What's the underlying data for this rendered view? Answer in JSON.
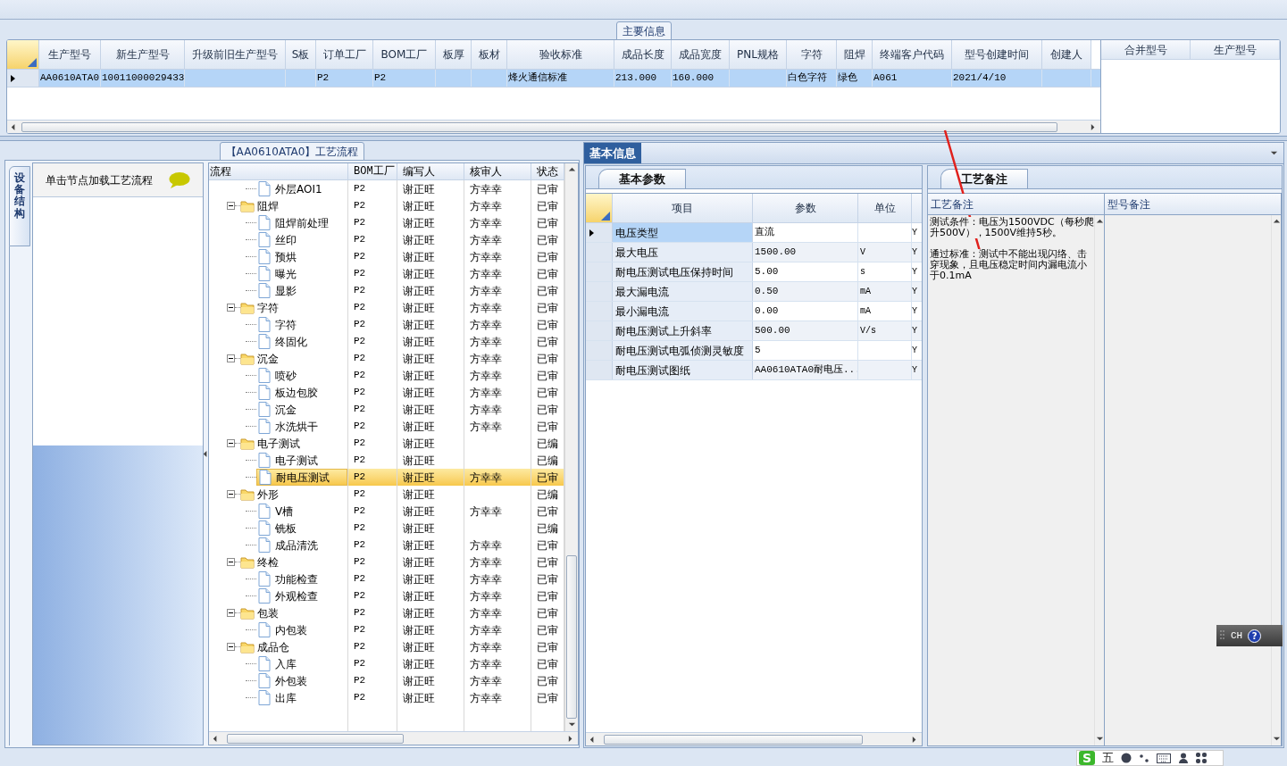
{
  "main_info": {
    "tab": "主要信息",
    "columns": [
      "生产型号",
      "新生产型号",
      "升级前旧生产型号",
      "S板",
      "订单工厂",
      "BOM工厂",
      "板厚",
      "板材",
      "验收标准",
      "成品长度",
      "成品宽度",
      "PNL规格",
      "字符",
      "阻焊",
      "终端客户代码",
      "型号创建时间",
      "创建人"
    ],
    "rows": [
      {
        "selected": true,
        "cells": [
          "AA0610ATA0",
          "10011000029433",
          null,
          null,
          "P2",
          "P2",
          null,
          null,
          "烽火通信标准",
          "213.000",
          "160.000",
          null,
          "白色字符",
          "绿色",
          "A061",
          "2021/4/10",
          null
        ]
      }
    ],
    "side_grid": {
      "columns": [
        "合并型号",
        "生产型号"
      ]
    }
  },
  "process_panel": {
    "tab": "【AA0610ATA0】工艺流程",
    "side_tab": "设备结构",
    "hint": "单击节点加载工艺流程",
    "tree": {
      "columns": [
        "流程",
        "BOM工厂",
        "编写人",
        "核审人",
        "状态"
      ],
      "nodes": [
        {
          "kind": "file",
          "label": "外层AOI1",
          "bom": "P2",
          "author": "谢正旺",
          "reviewer": "方幸幸",
          "status": "已审",
          "selected": false
        },
        {
          "kind": "folder",
          "label": "阻焊",
          "bom": "P2",
          "author": "谢正旺",
          "reviewer": "方幸幸",
          "status": "已审",
          "selected": false,
          "expanded": true,
          "children": [
            {
              "kind": "file",
              "label": "阻焊前处理",
              "bom": "P2",
              "author": "谢正旺",
              "reviewer": "方幸幸",
              "status": "已审",
              "selected": false
            },
            {
              "kind": "file",
              "label": "丝印",
              "bom": "P2",
              "author": "谢正旺",
              "reviewer": "方幸幸",
              "status": "已审",
              "selected": false
            },
            {
              "kind": "file",
              "label": "预烘",
              "bom": "P2",
              "author": "谢正旺",
              "reviewer": "方幸幸",
              "status": "已审",
              "selected": false
            },
            {
              "kind": "file",
              "label": "曝光",
              "bom": "P2",
              "author": "谢正旺",
              "reviewer": "方幸幸",
              "status": "已审",
              "selected": false
            },
            {
              "kind": "file",
              "label": "显影",
              "bom": "P2",
              "author": "谢正旺",
              "reviewer": "方幸幸",
              "status": "已审",
              "selected": false
            }
          ]
        },
        {
          "kind": "folder",
          "label": "字符",
          "bom": "P2",
          "author": "谢正旺",
          "reviewer": "方幸幸",
          "status": "已审",
          "selected": false,
          "expanded": true,
          "children": [
            {
              "kind": "file",
              "label": "字符",
              "bom": "P2",
              "author": "谢正旺",
              "reviewer": "方幸幸",
              "status": "已审",
              "selected": false
            },
            {
              "kind": "file",
              "label": "终固化",
              "bom": "P2",
              "author": "谢正旺",
              "reviewer": "方幸幸",
              "status": "已审",
              "selected": false
            }
          ]
        },
        {
          "kind": "folder",
          "label": "沉金",
          "bom": "P2",
          "author": "谢正旺",
          "reviewer": "方幸幸",
          "status": "已审",
          "selected": false,
          "expanded": true,
          "children": [
            {
              "kind": "file",
              "label": "喷砂",
              "bom": "P2",
              "author": "谢正旺",
              "reviewer": "方幸幸",
              "status": "已审",
              "selected": false
            },
            {
              "kind": "file",
              "label": "板边包胶",
              "bom": "P2",
              "author": "谢正旺",
              "reviewer": "方幸幸",
              "status": "已审",
              "selected": false
            },
            {
              "kind": "file",
              "label": "沉金",
              "bom": "P2",
              "author": "谢正旺",
              "reviewer": "方幸幸",
              "status": "已审",
              "selected": false
            },
            {
              "kind": "file",
              "label": "水洗烘干",
              "bom": "P2",
              "author": "谢正旺",
              "reviewer": "方幸幸",
              "status": "已审",
              "selected": false
            }
          ]
        },
        {
          "kind": "folder",
          "label": "电子测试",
          "bom": "P2",
          "author": "谢正旺",
          "status": "已编",
          "selected": false,
          "expanded": true,
          "children": [
            {
              "kind": "file",
              "label": "电子测试",
              "bom": "P2",
              "author": "谢正旺",
              "status": "已编",
              "selected": false
            },
            {
              "kind": "file",
              "label": "耐电压测试",
              "bom": "P2",
              "author": "谢正旺",
              "reviewer": "方幸幸",
              "status": "已审",
              "selected": true
            }
          ]
        },
        {
          "kind": "folder",
          "label": "外形",
          "bom": "P2",
          "author": "谢正旺",
          "status": "已编",
          "selected": false,
          "expanded": true,
          "children": [
            {
              "kind": "file",
              "label": "V槽",
              "bom": "P2",
              "author": "谢正旺",
              "reviewer": "方幸幸",
              "status": "已审",
              "selected": false
            },
            {
              "kind": "file",
              "label": "铣板",
              "bom": "P2",
              "author": "谢正旺",
              "status": "已编",
              "selected": false
            },
            {
              "kind": "file",
              "label": "成品清洗",
              "bom": "P2",
              "author": "谢正旺",
              "reviewer": "方幸幸",
              "status": "已审",
              "selected": false
            }
          ]
        },
        {
          "kind": "folder",
          "label": "终检",
          "bom": "P2",
          "author": "谢正旺",
          "reviewer": "方幸幸",
          "status": "已审",
          "selected": false,
          "expanded": true,
          "children": [
            {
              "kind": "file",
              "label": "功能检查",
              "bom": "P2",
              "author": "谢正旺",
              "reviewer": "方幸幸",
              "status": "已审",
              "selected": false
            },
            {
              "kind": "file",
              "label": "外观检查",
              "bom": "P2",
              "author": "谢正旺",
              "reviewer": "方幸幸",
              "status": "已审",
              "selected": false
            }
          ]
        },
        {
          "kind": "folder",
          "label": "包装",
          "bom": "P2",
          "author": "谢正旺",
          "reviewer": "方幸幸",
          "status": "已审",
          "selected": false,
          "expanded": true,
          "children": [
            {
              "kind": "file",
              "label": "内包装",
              "bom": "P2",
              "author": "谢正旺",
              "reviewer": "方幸幸",
              "status": "已审",
              "selected": false
            }
          ]
        },
        {
          "kind": "folder",
          "label": "成品仓",
          "bom": "P2",
          "author": "谢正旺",
          "reviewer": "方幸幸",
          "status": "已审",
          "selected": false,
          "expanded": true,
          "children": [
            {
              "kind": "file",
              "label": "入库",
              "bom": "P2",
              "author": "谢正旺",
              "reviewer": "方幸幸",
              "status": "已审",
              "selected": false
            },
            {
              "kind": "file",
              "label": "外包装",
              "bom": "P2",
              "author": "谢正旺",
              "reviewer": "方幸幸",
              "status": "已审",
              "selected": false
            },
            {
              "kind": "file",
              "label": "出库",
              "bom": "P2",
              "author": "谢正旺",
              "reviewer": "方幸幸",
              "status": "已审",
              "selected": false
            }
          ]
        }
      ]
    }
  },
  "detail_panel": {
    "tab": "基本信息",
    "params": {
      "tab": "基本参数",
      "columns": [
        "项目",
        "参数",
        "单位"
      ],
      "rows": [
        {
          "selected": true,
          "item": "电压类型",
          "value": "直流",
          "flag": "Y"
        },
        {
          "selected": false,
          "item": "最大电压",
          "value": "1500.00",
          "unit": "V",
          "flag": "Y"
        },
        {
          "selected": false,
          "item": "耐电压测试电压保持时间",
          "value": "5.00",
          "unit": "s",
          "flag": "Y"
        },
        {
          "selected": false,
          "item": "最大漏电流",
          "value": "0.50",
          "unit": "mA",
          "flag": "Y"
        },
        {
          "selected": false,
          "item": "最小漏电流",
          "value": "0.00",
          "unit": "mA",
          "flag": "Y"
        },
        {
          "selected": false,
          "item": "耐电压测试上升斜率",
          "value": "500.00",
          "unit": "V/s",
          "flag": "Y"
        },
        {
          "selected": false,
          "item": "耐电压测试电弧侦测灵敏度",
          "value": "5",
          "flag": "Y"
        },
        {
          "selected": false,
          "item": "耐电压测试图纸",
          "value": "AA0610ATA0耐电压...",
          "flag": "Y"
        }
      ]
    },
    "remarks": {
      "tab": "工艺备注",
      "columns": [
        "工艺备注",
        "型号备注"
      ],
      "text": [
        "测试条件：电压为1500VDC（每秒爬升500V），1500V维持5秒。",
        "通过标准：测试中不能出现闪络、击穿现象，且电压稳定时间内漏电流小于0.1mA"
      ]
    }
  },
  "ime_toolbar": {
    "label": "CH",
    "help": "?"
  },
  "ime_bar": {
    "logo": "S",
    "mode": "五"
  }
}
